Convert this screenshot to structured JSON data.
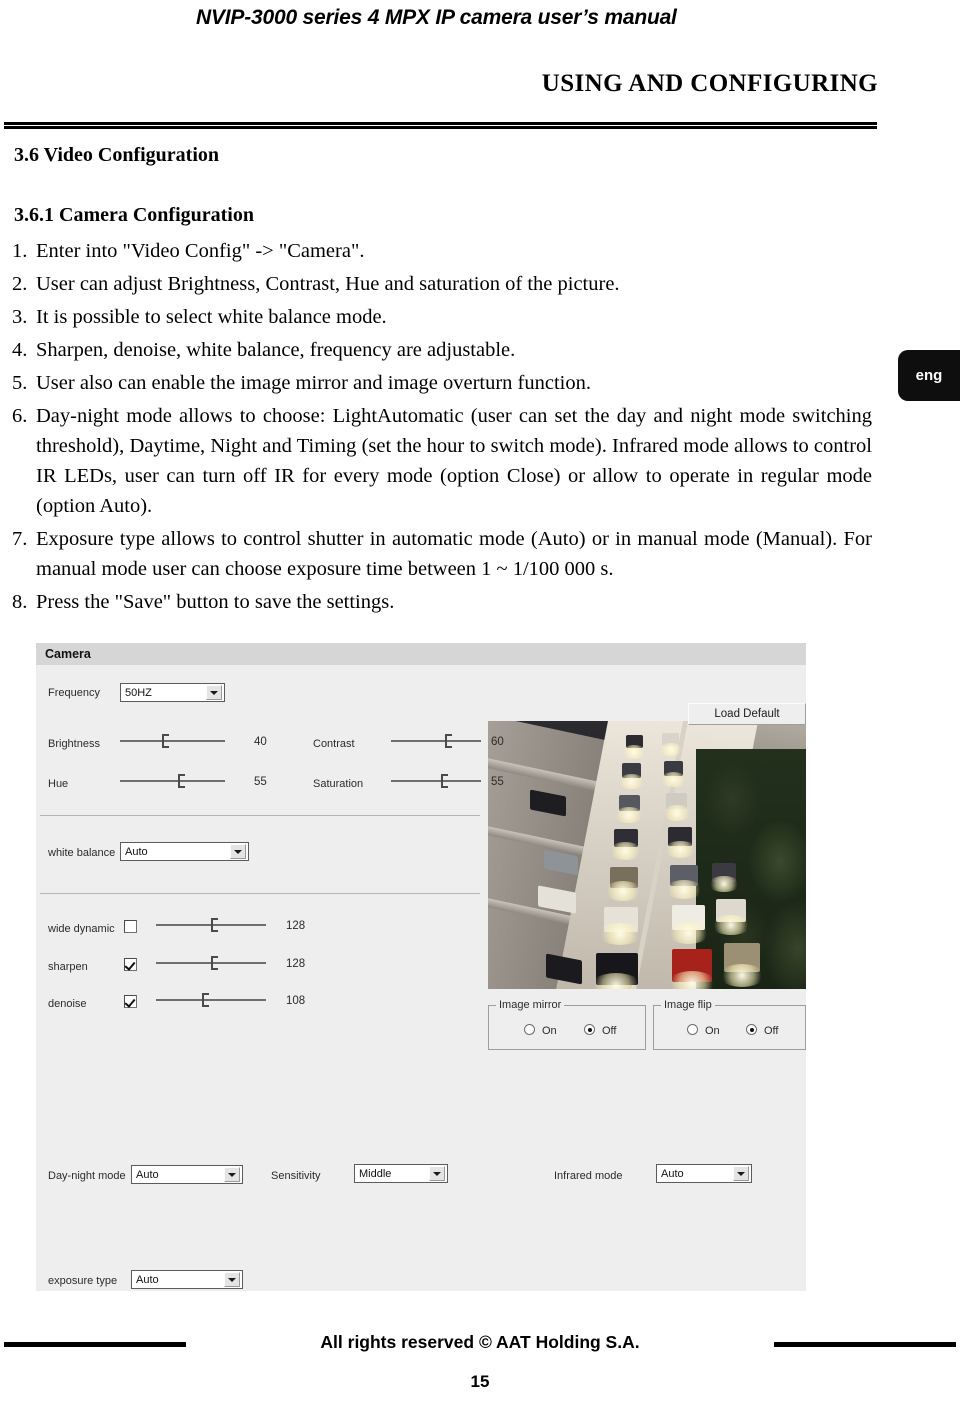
{
  "header": {
    "running_head": "NVIP-3000 series 4 MPX IP camera user’s manual",
    "section_banner": "USING AND CONFIGURING"
  },
  "language_tab": {
    "label": "eng"
  },
  "headings": {
    "section": "3.6 Video Configuration",
    "subsection": "3.6.1 Camera Configuration"
  },
  "steps": [
    {
      "num": "1.",
      "text": "Enter into \"Video Config\" ->  \"Camera\"."
    },
    {
      "num": "2.",
      "text": "User can adjust Brightness, Contrast, Hue and saturation of the picture."
    },
    {
      "num": "3.",
      "text": "It is possible to select white balance mode."
    },
    {
      "num": "4.",
      "text": "Sharpen, denoise, white balance, frequency are adjustable."
    },
    {
      "num": "5.",
      "text": "User also can enable the image mirror and image overturn function."
    },
    {
      "num": "6.",
      "text": "Day-night mode allows to choose: LightAutomatic (user can set the day and night mode switching threshold), Daytime, Night and Timing (set the hour to switch mode). Infrared mode allows to control IR LEDs, user can turn off IR for every mode (option Close) or allow to operate in regular mode (option Auto)."
    },
    {
      "num": "7.",
      "text": "Exposure type allows to control shutter in automatic mode (Auto) or in manual mode (Manual). For manual mode user can choose exposure time between 1 ~ 1/100 000 s."
    },
    {
      "num": "8.",
      "text": "Press the \"Save\" button to save the settings."
    }
  ],
  "camera_panel": {
    "title": "Camera",
    "load_default_button": "Load Default",
    "frequency": {
      "label": "Frequency",
      "value": "50HZ"
    },
    "sliders": [
      {
        "label": "Brightness",
        "value": "40",
        "percent": 40
      },
      {
        "label": "Contrast",
        "value": "60",
        "percent": 60
      },
      {
        "label": "Hue",
        "value": "55",
        "percent": 55
      },
      {
        "label": "Saturation",
        "value": "55",
        "percent": 55
      }
    ],
    "white_balance": {
      "label": "white balance",
      "value": "Auto"
    },
    "toggles": [
      {
        "label": "wide dynamic",
        "checked": false,
        "value": "128",
        "percent": 50
      },
      {
        "label": "sharpen",
        "checked": true,
        "value": "128",
        "percent": 50
      },
      {
        "label": "denoise",
        "checked": true,
        "value": "108",
        "percent": 42
      }
    ],
    "image_mirror": {
      "title": "Image mirror",
      "on_label": "On",
      "off_label": "Off",
      "selected": "Off"
    },
    "image_flip": {
      "title": "Image flip",
      "on_label": "On",
      "off_label": "Off",
      "selected": "Off"
    },
    "day_night_mode": {
      "label": "Day-night mode",
      "value": "Auto"
    },
    "sensitivity": {
      "label": "Sensitivity",
      "value": "Middle"
    },
    "infrared_mode": {
      "label": "Infrared mode",
      "value": "Auto"
    },
    "exposure_type": {
      "label": "exposure type",
      "value": "Auto"
    }
  },
  "footer": {
    "copyright": "All rights reserved © AAT Holding S.A.",
    "page_number": "15"
  }
}
